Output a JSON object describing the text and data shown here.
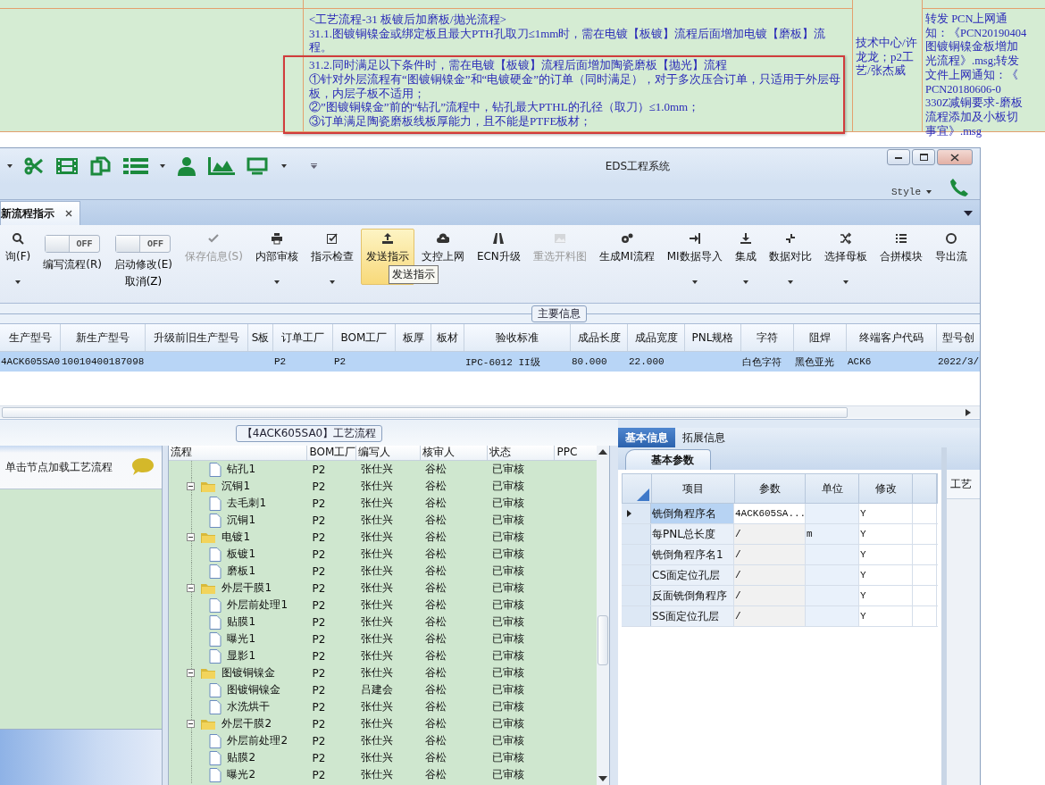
{
  "top_table": {
    "cells": [
      {
        "kind": "blank"
      },
      {
        "kind": "paragraphs",
        "paragraphs": [
          "<工艺流程-31 板镀后加磨板/抛光流程>",
          "31.1.图镀铜镍金或绑定板且最大PTH孔取刀≤1mm时，需在电镀【板镀】流程后面增加电镀【磨板】流程。",
          "31.2.同时满足以下条件时，需在电镀【板镀】流程后面增加陶瓷磨板【抛光】流程",
          "①针对外层流程有“图镀铜镍金”和“电镀硬金”的订单（同时满足），对于多次压合订单，只适用于外层母板，内层子板不适用；",
          "②”图镀铜镍金”前的“钻孔”流程中，钻孔最大PTHL的孔径（取刀）≤1.0mm；",
          "③订单满足陶瓷磨板线板厚能力，且不能是PTFE板材；"
        ]
      },
      {
        "kind": "text",
        "text": "技术中心/许龙龙；p2工艺/张杰威"
      },
      {
        "kind": "lines",
        "lines": [
          "转发  PCN上网通",
          "知：《PCN20190404",
          "图镀铜镍金板增加",
          "光流程》.msg;转发",
          "文件上网通知：《",
          "PCN20180606-0",
          "330Z减铜要求-磨板",
          "流程添加及小板切",
          "事宜》.msg"
        ]
      }
    ]
  },
  "window": {
    "title": "EDS工程系统",
    "style_menu": "Style"
  },
  "tab": {
    "label": "新流程指示",
    "closable": true
  },
  "ribbon": {
    "items": [
      {
        "kind": "button",
        "label": "询(F)",
        "disabled": false,
        "highlighted": false,
        "menu": true
      },
      {
        "kind": "toggle",
        "switch_text": "OFF",
        "on": false,
        "label": "编写流程(R)"
      },
      {
        "kind": "toggle",
        "switch_text": "OFF",
        "on": false,
        "label": "启动修改(E)",
        "sub_label": "取消(Z)"
      },
      {
        "kind": "button",
        "label": "保存信息(S)",
        "disabled": true,
        "highlighted": false,
        "menu": false
      },
      {
        "kind": "button",
        "label": "内部审核",
        "disabled": false,
        "highlighted": false,
        "menu": true
      },
      {
        "kind": "button",
        "label": "指示检查",
        "disabled": false,
        "highlighted": false,
        "menu": true
      },
      {
        "kind": "button",
        "label": "发送指示",
        "disabled": false,
        "highlighted": true,
        "menu": false,
        "tooltip": "发送指示"
      },
      {
        "kind": "button",
        "label": "文控上网",
        "disabled": false,
        "highlighted": false,
        "menu": false
      },
      {
        "kind": "button",
        "label": "ECN升级",
        "disabled": false,
        "highlighted": false,
        "menu": false
      },
      {
        "kind": "button",
        "label": "重选开料图",
        "disabled": true,
        "highlighted": false,
        "menu": false
      },
      {
        "kind": "button",
        "label": "生成MI流程",
        "disabled": false,
        "highlighted": false,
        "menu": false
      },
      {
        "kind": "button",
        "label": "MI数据导入",
        "disabled": false,
        "highlighted": false,
        "menu": true
      },
      {
        "kind": "button",
        "label": "集成",
        "disabled": false,
        "highlighted": false,
        "menu": true
      },
      {
        "kind": "button",
        "label": "数据对比",
        "disabled": false,
        "highlighted": false,
        "menu": true
      },
      {
        "kind": "button",
        "label": "选择母板",
        "disabled": false,
        "highlighted": false,
        "menu": true
      },
      {
        "kind": "button",
        "label": "合拼模块",
        "disabled": false,
        "highlighted": false,
        "menu": false
      },
      {
        "kind": "button",
        "label": "导出流",
        "disabled": false,
        "highlighted": false,
        "menu": false
      }
    ]
  },
  "main_info": {
    "title": "主要信息",
    "columns": [
      "生产型号",
      "新生产型号",
      "升级前旧生产型号",
      "S板",
      "订单工厂",
      "BOM工厂",
      "板厚",
      "板材",
      "验收标准",
      "成品长度",
      "成品宽度",
      "PNL规格",
      "字符",
      "阻焊",
      "终端客户代码",
      "型号创"
    ],
    "rows": [
      {
        "selected": true,
        "cells": [
          "4ACK605SA0",
          "10010400187098",
          null,
          null,
          "P2",
          "P2",
          null,
          null,
          "IPC-6012 II级",
          "80.000",
          "22.000",
          null,
          "白色字符",
          "黑色亚光",
          "ACK6",
          "2022/3/"
        ]
      }
    ]
  },
  "process": {
    "title": "【4ACK605SA0】工艺流程",
    "hint": "单击节点加载工艺流程",
    "columns": [
      "流程",
      "BOM工厂",
      "编写人",
      "核审人",
      "状态",
      "PPC"
    ],
    "nodes": [
      {
        "kind": "file",
        "name": "钻孔1",
        "bom": "P2",
        "writer": "张仕兴",
        "reviewer": "谷松",
        "status": "已审核"
      },
      {
        "kind": "folder",
        "expanded": true,
        "name": "沉铜1",
        "bom": "P2",
        "writer": "张仕兴",
        "reviewer": "谷松",
        "status": "已审核",
        "children": [
          {
            "kind": "file",
            "name": "去毛刺1",
            "bom": "P2",
            "writer": "张仕兴",
            "reviewer": "谷松",
            "status": "已审核"
          },
          {
            "kind": "file",
            "name": "沉铜1",
            "bom": "P2",
            "writer": "张仕兴",
            "reviewer": "谷松",
            "status": "已审核"
          }
        ]
      },
      {
        "kind": "folder",
        "expanded": true,
        "name": "电镀1",
        "bom": "P2",
        "writer": "张仕兴",
        "reviewer": "谷松",
        "status": "已审核",
        "children": [
          {
            "kind": "file",
            "name": "板镀1",
            "bom": "P2",
            "writer": "张仕兴",
            "reviewer": "谷松",
            "status": "已审核"
          },
          {
            "kind": "file",
            "name": "磨板1",
            "bom": "P2",
            "writer": "张仕兴",
            "reviewer": "谷松",
            "status": "已审核"
          }
        ]
      },
      {
        "kind": "folder",
        "expanded": true,
        "name": "外层干膜1",
        "bom": "P2",
        "writer": "张仕兴",
        "reviewer": "谷松",
        "status": "已审核",
        "children": [
          {
            "kind": "file",
            "name": "外层前处理1",
            "bom": "P2",
            "writer": "张仕兴",
            "reviewer": "谷松",
            "status": "已审核"
          },
          {
            "kind": "file",
            "name": "贴膜1",
            "bom": "P2",
            "writer": "张仕兴",
            "reviewer": "谷松",
            "status": "已审核"
          },
          {
            "kind": "file",
            "name": "曝光1",
            "bom": "P2",
            "writer": "张仕兴",
            "reviewer": "谷松",
            "status": "已审核"
          },
          {
            "kind": "file",
            "name": "显影1",
            "bom": "P2",
            "writer": "张仕兴",
            "reviewer": "谷松",
            "status": "已审核"
          }
        ]
      },
      {
        "kind": "folder",
        "expanded": true,
        "name": "图镀铜镍金",
        "bom": "P2",
        "writer": "张仕兴",
        "reviewer": "谷松",
        "status": "已审核",
        "children": [
          {
            "kind": "file",
            "name": "图镀铜镍金",
            "bom": "P2",
            "writer": "吕建会",
            "reviewer": "谷松",
            "status": "已审核"
          },
          {
            "kind": "file",
            "name": "水洗烘干",
            "bom": "P2",
            "writer": "张仕兴",
            "reviewer": "谷松",
            "status": "已审核"
          }
        ]
      },
      {
        "kind": "folder",
        "expanded": true,
        "name": "外层干膜2",
        "bom": "P2",
        "writer": "张仕兴",
        "reviewer": "谷松",
        "status": "已审核",
        "children": [
          {
            "kind": "file",
            "name": "外层前处理2",
            "bom": "P2",
            "writer": "张仕兴",
            "reviewer": "谷松",
            "status": "已审核"
          },
          {
            "kind": "file",
            "name": "贴膜2",
            "bom": "P2",
            "writer": "张仕兴",
            "reviewer": "谷松",
            "status": "已审核"
          },
          {
            "kind": "file",
            "name": "曝光2",
            "bom": "P2",
            "writer": "张仕兴",
            "reviewer": "谷松",
            "status": "已审核"
          }
        ]
      }
    ]
  },
  "detail": {
    "tabs": [
      {
        "label": "基本信息",
        "selected": true
      },
      {
        "label": "拓展信息",
        "selected": false
      }
    ],
    "sub_tab": "基本参数",
    "columns": [
      "项目",
      "参数",
      "单位",
      "修改"
    ],
    "rows": [
      {
        "current": true,
        "item": "铣倒角程序名",
        "param": "4ACK605SA...",
        "modify": "Y"
      },
      {
        "current": false,
        "item": "每PNL总长度",
        "param": "/",
        "unit": "m",
        "modify": "Y"
      },
      {
        "current": false,
        "item": "铣倒角程序名1",
        "param": "/",
        "modify": "Y"
      },
      {
        "current": false,
        "item": "CS面定位孔层",
        "param": "/",
        "modify": "Y"
      },
      {
        "current": false,
        "item": "反面铣倒角程序",
        "param": "/",
        "modify": "Y"
      },
      {
        "current": false,
        "item": "SS面定位孔层",
        "param": "/",
        "modify": "Y"
      }
    ],
    "side_panel_header": "工艺"
  }
}
